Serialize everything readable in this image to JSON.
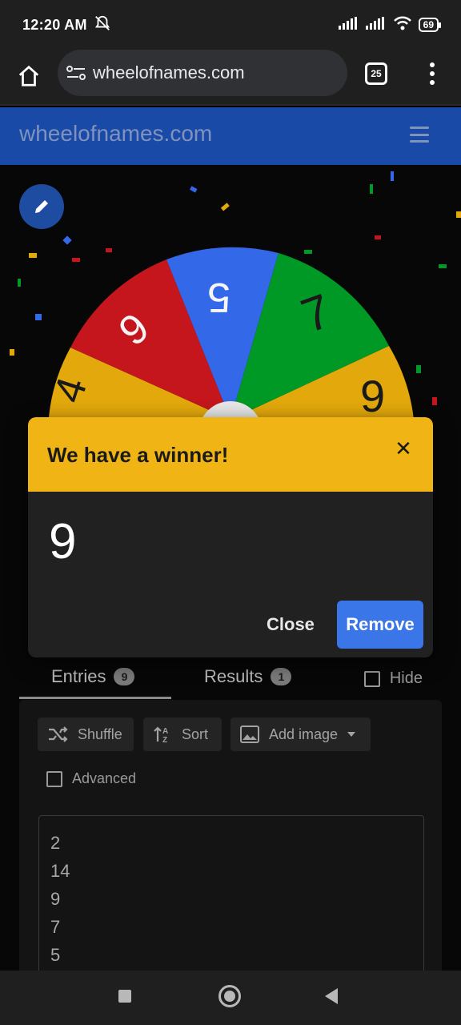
{
  "status_bar": {
    "time": "12:20 AM",
    "battery": "69"
  },
  "browser": {
    "url": "wheelofnames.com",
    "tab_count": "25"
  },
  "site": {
    "title": "wheelofnames.com"
  },
  "wheel": {
    "segments": [
      {
        "label": "4",
        "color": "#e2a80c"
      },
      {
        "label": "9",
        "color": "#c4161c"
      },
      {
        "label": "5",
        "color": "#3369e8"
      },
      {
        "label": "7",
        "color": "#009925"
      },
      {
        "label": "9",
        "color": "#e2a80c"
      }
    ]
  },
  "tabs": {
    "entries_label": "Entries",
    "entries_count": "9",
    "results_label": "Results",
    "results_count": "1",
    "hide_label": "Hide"
  },
  "toolbar": {
    "shuffle_label": "Shuffle",
    "sort_label": "Sort",
    "add_image_label": "Add image",
    "advanced_label": "Advanced"
  },
  "entries": [
    "2",
    "14",
    "9",
    "7",
    "5"
  ],
  "dialog": {
    "title": "We have a winner!",
    "winner": "9",
    "close_label": "Close",
    "remove_label": "Remove"
  },
  "colors": {
    "accent": "#3a76e8",
    "dialog_header": "#f0b414",
    "site_header": "#1a4aa8"
  }
}
